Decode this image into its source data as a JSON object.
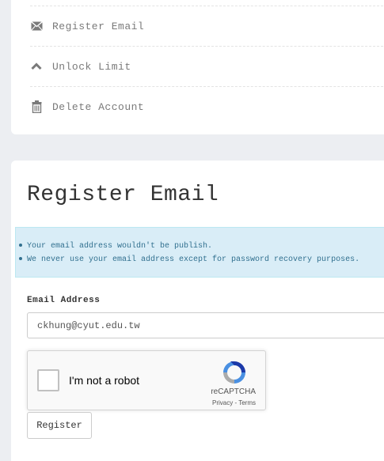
{
  "menu": {
    "items": [
      {
        "label": "Register Email",
        "icon": "envelope-icon"
      },
      {
        "label": "Unlock Limit",
        "icon": "chevron-up-icon"
      },
      {
        "label": "Delete Account",
        "icon": "trash-icon"
      }
    ]
  },
  "form": {
    "title": "Register Email",
    "info": [
      "Your email address wouldn't be publish.",
      "We never use your email address except for password recovery purposes."
    ],
    "email_label": "Email Address",
    "email_value": "ckhung@cyut.edu.tw",
    "recaptcha": {
      "label": "I'm not a robot",
      "brand": "reCAPTCHA",
      "links": "Privacy - Terms"
    },
    "submit_label": "Register"
  },
  "colors": {
    "background": "#eceef2",
    "info_bg": "#d9edf7",
    "info_text": "#31708f",
    "menu_text": "#7a7a7a"
  }
}
